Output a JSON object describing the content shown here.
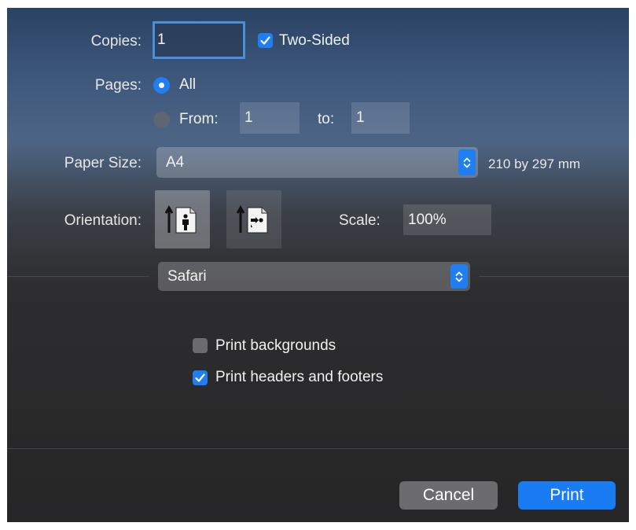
{
  "copies": {
    "label": "Copies:",
    "value": "1"
  },
  "two_sided": {
    "label": "Two-Sided",
    "checked": true
  },
  "pages": {
    "label": "Pages:",
    "all_label": "All",
    "from_label": "From:",
    "from_value": "1",
    "to_label": "to:",
    "to_value": "1",
    "selected": "all"
  },
  "paper_size": {
    "label": "Paper Size:",
    "value": "A4",
    "dimensions": "210 by 297 mm"
  },
  "orientation": {
    "label": "Orientation:",
    "selected": "portrait"
  },
  "scale": {
    "label": "Scale:",
    "value": "100%"
  },
  "app_menu": {
    "value": "Safari"
  },
  "print_backgrounds": {
    "label": "Print backgrounds",
    "checked": false
  },
  "print_headers_footers": {
    "label": "Print headers and footers",
    "checked": true
  },
  "buttons": {
    "cancel": "Cancel",
    "print": "Print"
  },
  "colors": {
    "accent": "#1f7ef2",
    "dialog_top": "#2a4263",
    "dialog_bottom": "#262627"
  },
  "icons": {
    "checkmark": "checkmark-icon",
    "stepper": "up-down-chevron-icon",
    "portrait": "portrait-orientation-icon",
    "landscape": "landscape-orientation-icon"
  }
}
